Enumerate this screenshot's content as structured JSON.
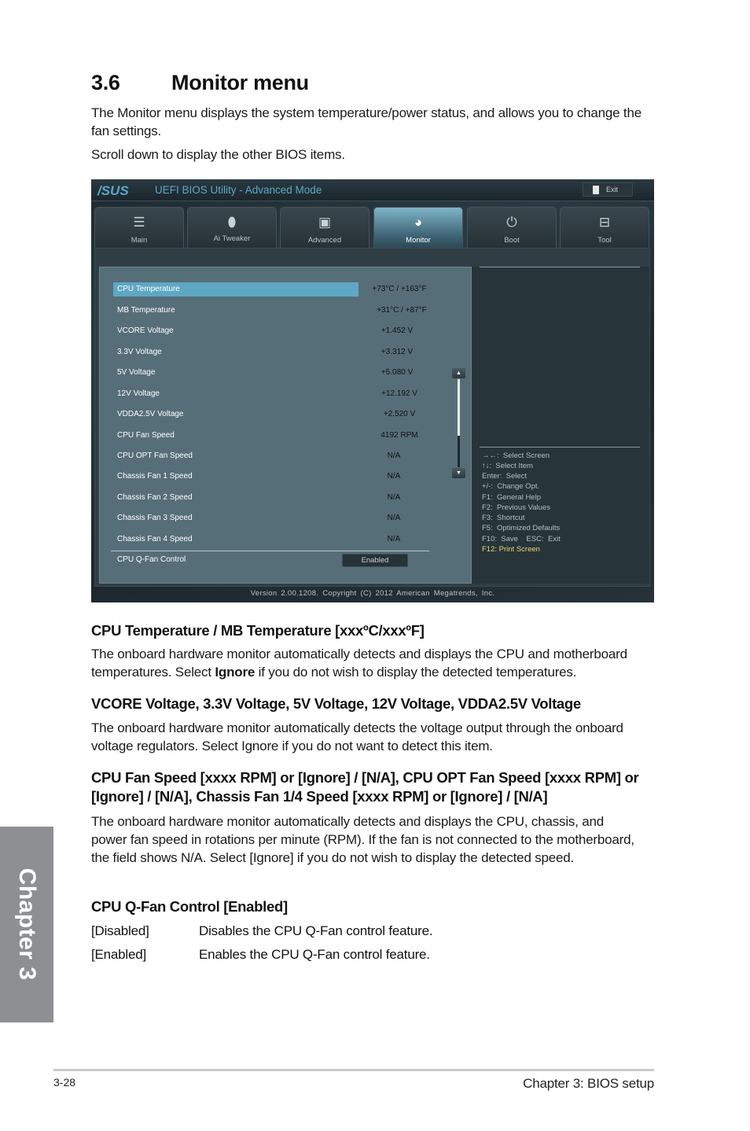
{
  "section": {
    "number": "3.6",
    "title": "Monitor menu",
    "intro": "The Monitor menu displays the system temperature/power status, and allows you to change the fan settings.",
    "scroll_note": "Scroll down to display the other BIOS items."
  },
  "bios": {
    "logo": "/SUS",
    "title": "UEFI BIOS Utility - Advanced Mode",
    "exit_label": "Exit",
    "tabs": [
      {
        "label": "Main",
        "icon": "list-icon"
      },
      {
        "label": "Ai  Tweaker",
        "icon": "tweaker-icon"
      },
      {
        "label": "Advanced",
        "icon": "advanced-icon"
      },
      {
        "label": "Monitor",
        "icon": "monitor-icon",
        "active": true
      },
      {
        "label": "Boot",
        "icon": "power-icon"
      },
      {
        "label": "Tool",
        "icon": "toolbox-icon"
      }
    ],
    "items": [
      {
        "name": "CPU Temperature",
        "value": "+73°C / +163°F",
        "selected": true
      },
      {
        "name": "MB Temperature",
        "value": "+31°C / +87°F"
      },
      {
        "name": "VCORE Voltage",
        "value": "+1.452 V"
      },
      {
        "name": "3.3V Voltage",
        "value": "+3.312 V"
      },
      {
        "name": "5V Voltage",
        "value": "+5.080 V"
      },
      {
        "name": "12V Voltage",
        "value": "+12.192 V"
      },
      {
        "name": "VDDA2.5V Voltage",
        "value": "+2.520 V"
      },
      {
        "name": "CPU Fan Speed",
        "value": "4192 RPM"
      },
      {
        "name": "CPU OPT Fan Speed",
        "value": "N/A"
      },
      {
        "name": "Chassis Fan 1 Speed",
        "value": "N/A"
      },
      {
        "name": "Chassis Fan 2 Speed",
        "value": "N/A"
      },
      {
        "name": "Chassis Fan 3 Speed",
        "value": "N/A"
      },
      {
        "name": "Chassis Fan 4 Speed",
        "value": "N/A"
      }
    ],
    "qfan": {
      "name": "CPU Q-Fan Control",
      "value": "Enabled"
    },
    "scrollbar_position": 0.0,
    "help": [
      "→←:  Select Screen",
      "↑↓:  Select Item",
      "Enter:  Select",
      "+/-:  Change Opt.",
      "F1:  General Help",
      "F2:  Previous Values",
      "F3:  Shortcut",
      "F5:  Optimized Defaults",
      "F10:  Save    ESC:  Exit",
      "F12: Print Screen"
    ],
    "footer": "Version  2.00.1208.   Copyright  (C)  2012  American  Megatrends,  Inc.",
    "colors": {
      "accent": "#5aa8c8",
      "selected_row": "#5ea8c4",
      "highlight_help": "#e8d870"
    }
  },
  "subsections": [
    {
      "heading": "CPU Temperature / MB Temperature [xxxºC/xxxºF]",
      "body_pre": "The onboard hardware monitor automatically detects and displays the CPU and motherboard temperatures. Select ",
      "body_bold": "Ignore",
      "body_post": " if you do not wish to display the detected temperatures."
    },
    {
      "heading": "VCORE Voltage, 3.3V Voltage, 5V Voltage, 12V Voltage, VDDA2.5V Voltage",
      "body": "The onboard hardware monitor automatically detects the voltage output through the onboard voltage regulators. Select Ignore if you do not want to detect this item."
    },
    {
      "heading": "CPU Fan Speed [xxxx RPM] or [Ignore] / [N/A], CPU OPT Fan Speed [xxxx RPM] or [Ignore] / [N/A], Chassis Fan 1/4 Speed [xxxx RPM] or [Ignore] / [N/A]",
      "body": "The onboard hardware monitor automatically detects and displays the CPU, chassis, and power fan speed in rotations per minute (RPM). If the fan is not connected to the motherboard, the field shows N/A. Select [Ignore] if you do not wish to display the detected speed."
    },
    {
      "heading": "CPU Q-Fan Control [Enabled]",
      "options": [
        {
          "key": "[Disabled]",
          "desc": "Disables the CPU Q-Fan control feature."
        },
        {
          "key": "[Enabled]",
          "desc": "Enables the CPU Q-Fan control feature."
        }
      ]
    }
  ],
  "chapter_tab": "Chapter 3",
  "footer": {
    "page_number": "3-28",
    "chapter": "Chapter 3: BIOS setup"
  }
}
